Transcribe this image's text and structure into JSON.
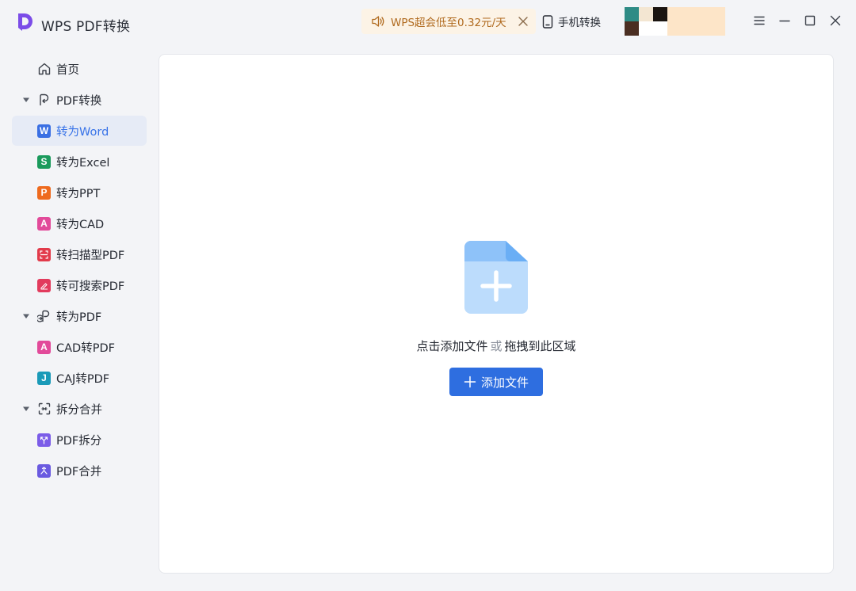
{
  "app": {
    "title": "WPS PDF转换",
    "logo_icon": "wps-pdf-logo",
    "accent_color": "#7b4ce8"
  },
  "header": {
    "promo": {
      "icon": "speaker-icon",
      "text": "WPS超会低至0.32元/天",
      "text_color": "#b06a1e",
      "background": "#fcf3e6"
    },
    "mobile": {
      "icon": "phone-icon",
      "label": "手机转换"
    },
    "window_controls": [
      "menu-icon",
      "minimize-icon",
      "maximize-icon",
      "close-icon"
    ]
  },
  "sidebar": {
    "active_color": "#3873e8",
    "items": [
      {
        "label": "首页",
        "icon": "home-icon",
        "level": 0
      },
      {
        "label": "PDF转换",
        "icon": "pdf-convert-icon",
        "level": 0,
        "collapsible": true,
        "expanded": true
      },
      {
        "label": "转为Word",
        "icon": "word-icon",
        "badge": "W",
        "color": "#3a6fe3",
        "level": 1,
        "active": true
      },
      {
        "label": "转为Excel",
        "icon": "excel-icon",
        "badge": "S",
        "color": "#1a9a5c",
        "level": 1
      },
      {
        "label": "转为PPT",
        "icon": "ppt-icon",
        "badge": "P",
        "color": "#ee6a1e",
        "level": 1
      },
      {
        "label": "转为CAD",
        "icon": "cad-icon",
        "badge": "A",
        "color": "#e24a9a",
        "level": 1
      },
      {
        "label": "转扫描型PDF",
        "icon": "scan-pdf-icon",
        "color": "#e23b4b",
        "level": 1
      },
      {
        "label": "转可搜索PDF",
        "icon": "searchable-pdf-icon",
        "color": "#e23b5d",
        "level": 1
      },
      {
        "label": "转为PDF",
        "icon": "to-pdf-icon",
        "level": 0,
        "collapsible": true,
        "expanded": true
      },
      {
        "label": "CAD转PDF",
        "icon": "cad-icon",
        "badge": "A",
        "color": "#e24a9a",
        "level": 1
      },
      {
        "label": "CAJ转PDF",
        "icon": "caj-icon",
        "badge": "J",
        "color": "#1a9ab8",
        "level": 1
      },
      {
        "label": "拆分合并",
        "icon": "split-merge-icon",
        "level": 0,
        "collapsible": true,
        "expanded": true
      },
      {
        "label": "PDF拆分",
        "icon": "pdf-split-icon",
        "color": "#7b5ce8",
        "level": 1
      },
      {
        "label": "PDF合并",
        "icon": "pdf-merge-icon",
        "color": "#6a5ae0",
        "level": 1
      }
    ]
  },
  "main": {
    "upload_icon": "add-file-icon",
    "drop_text_click": "点击添加文件",
    "drop_text_or": "或",
    "drop_text_drag": "拖拽到此区域",
    "add_button_label": "添加文件",
    "add_button_color": "#2e6ee0"
  }
}
